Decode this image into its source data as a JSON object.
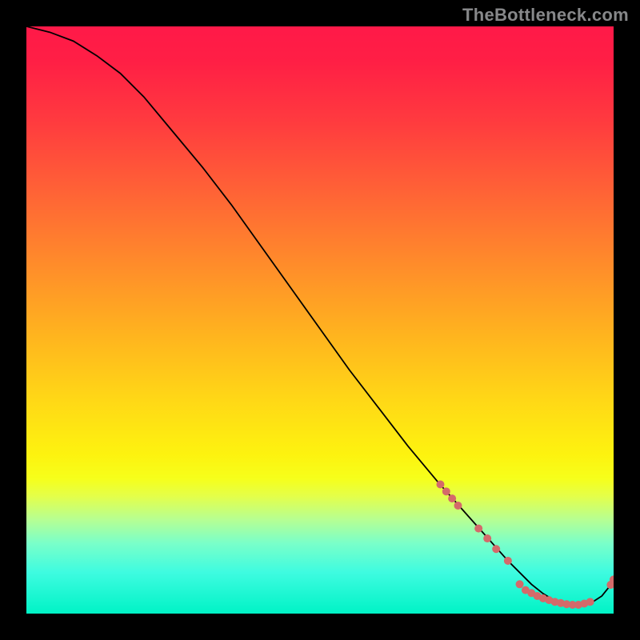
{
  "watermark": "TheBottleneck.com",
  "colors": {
    "page_bg": "#000000",
    "watermark": "#87888a",
    "curve": "#000000",
    "dot": "#d46a6a"
  },
  "chart_data": {
    "type": "line",
    "title": "",
    "xlabel": "",
    "ylabel": "",
    "xlim": [
      0,
      100
    ],
    "ylim": [
      0,
      100
    ],
    "grid": false,
    "legend": false,
    "series": [
      {
        "name": "bottleneck-curve",
        "x": [
          0,
          4,
          8,
          12,
          16,
          20,
          25,
          30,
          35,
          40,
          45,
          50,
          55,
          60,
          65,
          70,
          74,
          78,
          82,
          86,
          88,
          90,
          92,
          94,
          96,
          98,
          100
        ],
        "y": [
          100,
          99,
          97.5,
          95,
          92,
          88,
          82,
          76,
          69.5,
          62.5,
          55.5,
          48.5,
          41.5,
          35,
          28.5,
          22.5,
          18,
          13.5,
          9,
          5,
          3.4,
          2.2,
          1.6,
          1.4,
          1.7,
          3.0,
          5.5
        ]
      }
    ],
    "markers": [
      {
        "x": 70.5,
        "y": 22.0
      },
      {
        "x": 71.5,
        "y": 20.8
      },
      {
        "x": 72.5,
        "y": 19.6
      },
      {
        "x": 73.5,
        "y": 18.4
      },
      {
        "x": 77.0,
        "y": 14.5
      },
      {
        "x": 78.5,
        "y": 12.8
      },
      {
        "x": 80.0,
        "y": 11.0
      },
      {
        "x": 82.0,
        "y": 9.0
      },
      {
        "x": 84.0,
        "y": 5.0
      },
      {
        "x": 85.0,
        "y": 4.0
      },
      {
        "x": 86.0,
        "y": 3.5
      },
      {
        "x": 87.0,
        "y": 3.0
      },
      {
        "x": 88.0,
        "y": 2.6
      },
      {
        "x": 89.0,
        "y": 2.3
      },
      {
        "x": 90.0,
        "y": 2.0
      },
      {
        "x": 91.0,
        "y": 1.8
      },
      {
        "x": 92.0,
        "y": 1.6
      },
      {
        "x": 93.0,
        "y": 1.5
      },
      {
        "x": 94.0,
        "y": 1.5
      },
      {
        "x": 95.0,
        "y": 1.7
      },
      {
        "x": 96.0,
        "y": 2.0
      },
      {
        "x": 99.5,
        "y": 4.9
      },
      {
        "x": 100.0,
        "y": 5.8
      }
    ],
    "gradient_stops": [
      {
        "pos": 0.0,
        "color": "#ff1948"
      },
      {
        "pos": 0.3,
        "color": "#ff6a33"
      },
      {
        "pos": 0.55,
        "color": "#ffc41c"
      },
      {
        "pos": 0.74,
        "color": "#fdf30f"
      },
      {
        "pos": 0.84,
        "color": "#b6ff93"
      },
      {
        "pos": 1.0,
        "color": "#00f3c6"
      }
    ]
  }
}
